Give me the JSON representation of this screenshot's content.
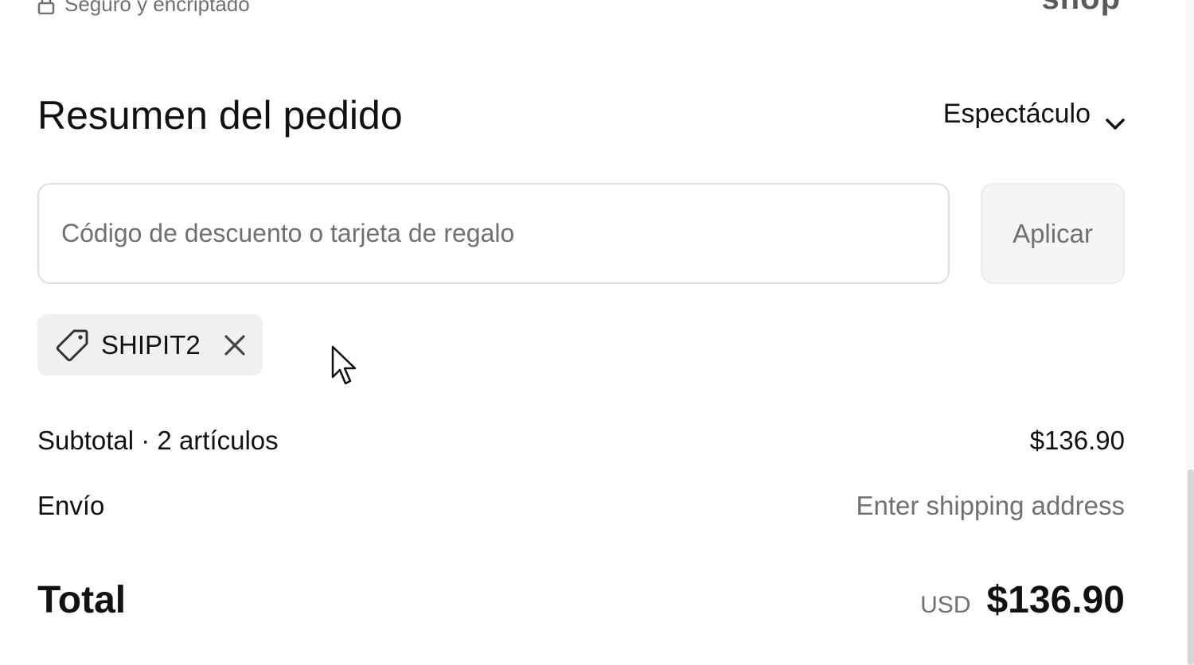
{
  "header_strip": {
    "secure_text": "Seguro y encriptado",
    "brand_text": "shop"
  },
  "summary": {
    "title": "Resumen del pedido",
    "toggle_label": "Espectáculo"
  },
  "discount": {
    "placeholder": "Código de descuento o tarjeta de regalo",
    "value": "",
    "apply_label": "Aplicar",
    "applied_code": "SHIPIT2"
  },
  "costs": {
    "subtotal_label": "Subtotal · 2 artículos",
    "subtotal_value": "$136.90",
    "shipping_label": "Envío",
    "shipping_value": "Enter shipping address",
    "total_label": "Total",
    "currency": "USD",
    "total_value": "$136.90"
  },
  "icons": {
    "lock": "lock-icon",
    "chevron": "chevron-down-icon",
    "tag": "tag-icon",
    "remove": "close-icon"
  },
  "colors": {
    "text_primary": "#111111",
    "text_muted": "#707070",
    "border": "#dedede",
    "chip_bg": "#f0f0f0",
    "button_bg": "#f5f5f5"
  }
}
